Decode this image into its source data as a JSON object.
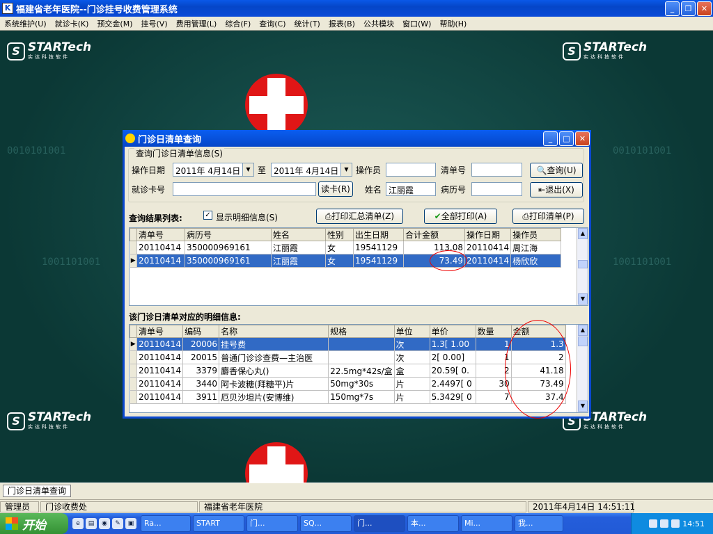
{
  "window": {
    "title": "福建省老年医院--门诊挂号收费管理系统"
  },
  "menu": [
    "系统维护(U)",
    "就诊卡(K)",
    "预交金(M)",
    "挂号(V)",
    "费用管理(L)",
    "综合(F)",
    "查询(C)",
    "统计(T)",
    "报表(B)",
    "公共模块",
    "窗口(W)",
    "帮助(H)"
  ],
  "brand": {
    "name": "STARTech",
    "tagline": "实达科技软件"
  },
  "background": {
    "bin1": "0010101001",
    "bin2": "1001101001"
  },
  "dialog": {
    "title": "门诊日清单查询",
    "group_label": "查询门诊日清单信息(S)",
    "op_date_label": "操作日期",
    "date_from": "2011年 4月14日",
    "to_label": "至",
    "date_to": "2011年 4月14日",
    "operator_label": "操作员",
    "operator_value": "",
    "bill_no_label": "清单号",
    "bill_no_value": "",
    "card_no_label": "就诊卡号",
    "card_no_value": "",
    "read_card_btn": "读卡(R)",
    "name_label": "姓名",
    "name_value": "江丽霞",
    "record_no_label": "病历号",
    "record_no_value": "",
    "query_btn": "查询(U)",
    "exit_btn": "退出(X)",
    "result_label": "查询结果列表:",
    "show_detail_label": "显示明细信息(S)",
    "show_detail_checked": true,
    "print_summary_btn": "打印汇总清单(Z)",
    "print_all_btn": "全部打印(A)",
    "print_btn": "打印清单(P)",
    "detail_label": "该门诊日清单对应的明细信息:"
  },
  "results": {
    "columns": [
      "清单号",
      "病历号",
      "姓名",
      "性别",
      "出生日期",
      "合计金额",
      "操作日期",
      "操作员"
    ],
    "rows": [
      [
        "20110414",
        "350000969161",
        "江丽霞",
        "女",
        "19541129",
        "113.08",
        "20110414",
        "周江海"
      ],
      [
        "20110414",
        "350000969161",
        "江丽霞",
        "女",
        "19541129",
        "73.49",
        "20110414",
        "杨欣欣"
      ]
    ],
    "selected_row": 1
  },
  "details": {
    "columns": [
      "清单号",
      "编码",
      "名称",
      "规格",
      "单位",
      "单价",
      "数量",
      "金额"
    ],
    "rows": [
      [
        "20110414",
        "20006",
        "挂号费",
        "",
        "次",
        "1.3[ 1.00",
        "1",
        "1.3"
      ],
      [
        "20110414",
        "20015",
        "普通门诊诊查费—主治医",
        "",
        "次",
        "2[ 0.00]",
        "1",
        "2"
      ],
      [
        "20110414",
        "3379",
        "麝香保心丸()",
        "22.5mg*42s/盒",
        "盒",
        "20.59[ 0.",
        "2",
        "41.18"
      ],
      [
        "20110414",
        "3440",
        "阿卡波糖(拜糖平)片",
        "50mg*30s",
        "片",
        "2.4497[ 0",
        "30",
        "73.49"
      ],
      [
        "20110414",
        "3911",
        "厄贝沙坦片(安博维)",
        "150mg*7s",
        "片",
        "5.3429[ 0",
        "7",
        "37.4"
      ]
    ],
    "selected_row": 0
  },
  "taskband": {
    "tab": "门诊日清单查询"
  },
  "status": {
    "user": "管理员",
    "dept": "门诊收费处",
    "hospital": "福建省老年医院",
    "datetime": "2011年4月14日  14:51:11"
  },
  "taskbar": {
    "start": "开始",
    "tasks": [
      "Ra...",
      "START",
      "门...",
      "SQ...",
      "门...",
      "本...",
      "Mi...",
      "我..."
    ],
    "active_task": 4,
    "clock": "14:51"
  }
}
